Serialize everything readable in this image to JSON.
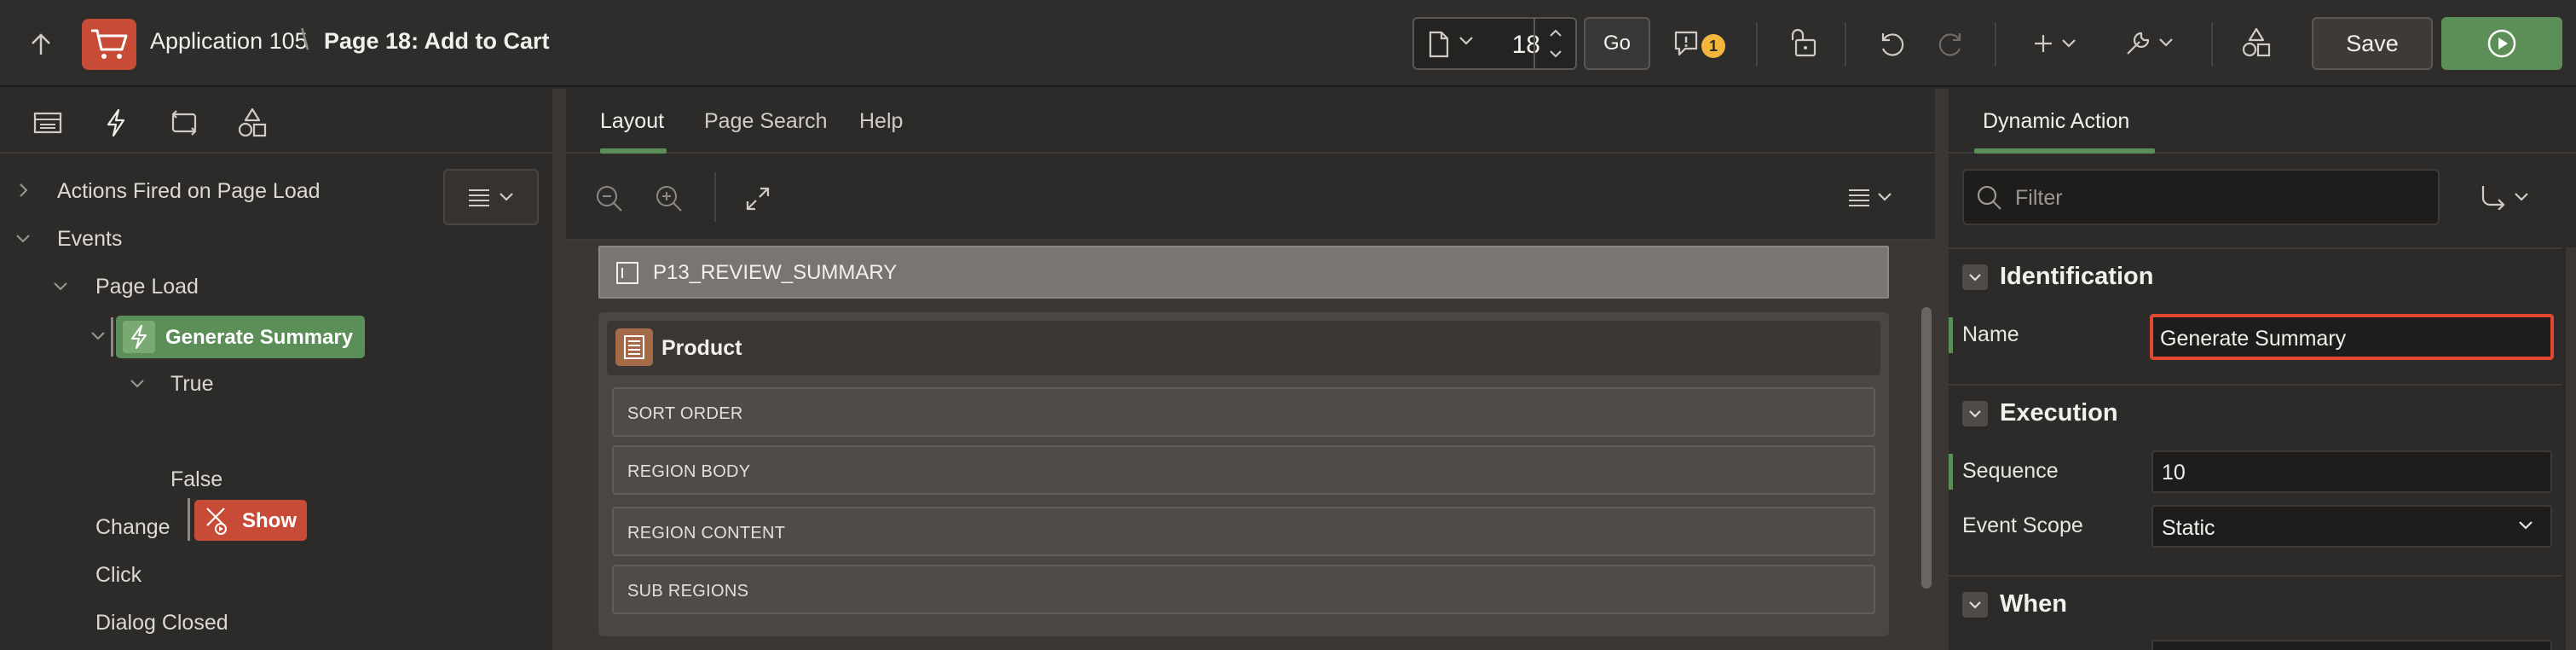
{
  "header": {
    "app_name": "Application 105",
    "separator": "\\",
    "page_title": "Page 18: Add to Cart",
    "page_number": "18",
    "go_label": "Go",
    "issues_count": "1",
    "save_label": "Save"
  },
  "left_panel": {
    "tabs": [
      "rendering-tab",
      "dynamic-actions-tab",
      "processing-tab",
      "shared-components-tab"
    ],
    "tree": {
      "actions_fired": "Actions Fired on Page Load",
      "events": "Events",
      "page_load": "Page Load",
      "generate_summary": "Generate Summary",
      "true_label": "True",
      "show": "Show",
      "false_label": "False",
      "change": "Change",
      "click": "Click",
      "dialog_closed": "Dialog Closed"
    }
  },
  "center": {
    "tabs": [
      "Layout",
      "Page Search",
      "Help"
    ],
    "active_tab": "Layout",
    "region_item": "P13_REVIEW_SUMMARY",
    "product_title": "Product",
    "slots": [
      "SORT ORDER",
      "REGION BODY",
      "REGION CONTENT",
      "SUB REGIONS"
    ]
  },
  "right_panel": {
    "tab": "Dynamic Action",
    "filter_placeholder": "Filter",
    "sections": {
      "identification": "Identification",
      "execution": "Execution",
      "when": "When"
    },
    "properties": {
      "name_label": "Name",
      "name_value": "Generate Summary",
      "sequence_label": "Sequence",
      "sequence_value": "10",
      "event_scope_label": "Event Scope",
      "event_scope_value": "Static"
    }
  },
  "colors": {
    "accent_green": "#5b8f57",
    "accent_red": "#c84b37",
    "focus_red": "#e0482f",
    "badge_yellow": "#f2b63d"
  }
}
